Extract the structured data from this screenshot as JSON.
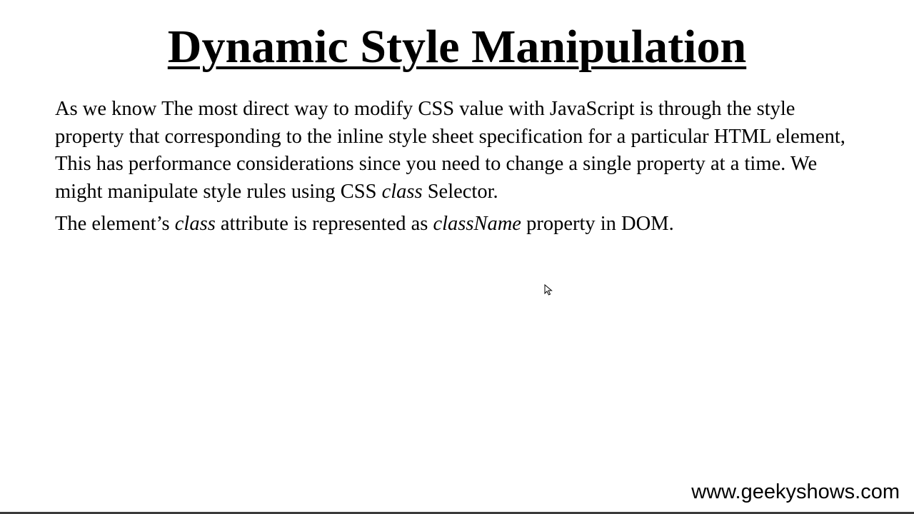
{
  "slide": {
    "title": "Dynamic Style Manipulation",
    "paragraph1": {
      "part1": "As we know The most direct way to modify CSS value with JavaScript is through the style property that corresponding to the inline style sheet specification for a particular HTML element, This has performance considerations since you need to change a single property at a time. We might manipulate style rules using CSS ",
      "italic1": "class",
      "part2": " Selector."
    },
    "paragraph2": {
      "part1": "The element’s ",
      "italic1": "class",
      "part2": " attribute is represented as ",
      "italic2": "className",
      "part3": " property in DOM."
    },
    "footer": "www.geekyshows.com"
  },
  "icons": {
    "cursor": "mouse-pointer-icon"
  },
  "colors": {
    "background": "#ffffff",
    "text": "#000000",
    "bottom_bar": "#3a3a3a"
  }
}
